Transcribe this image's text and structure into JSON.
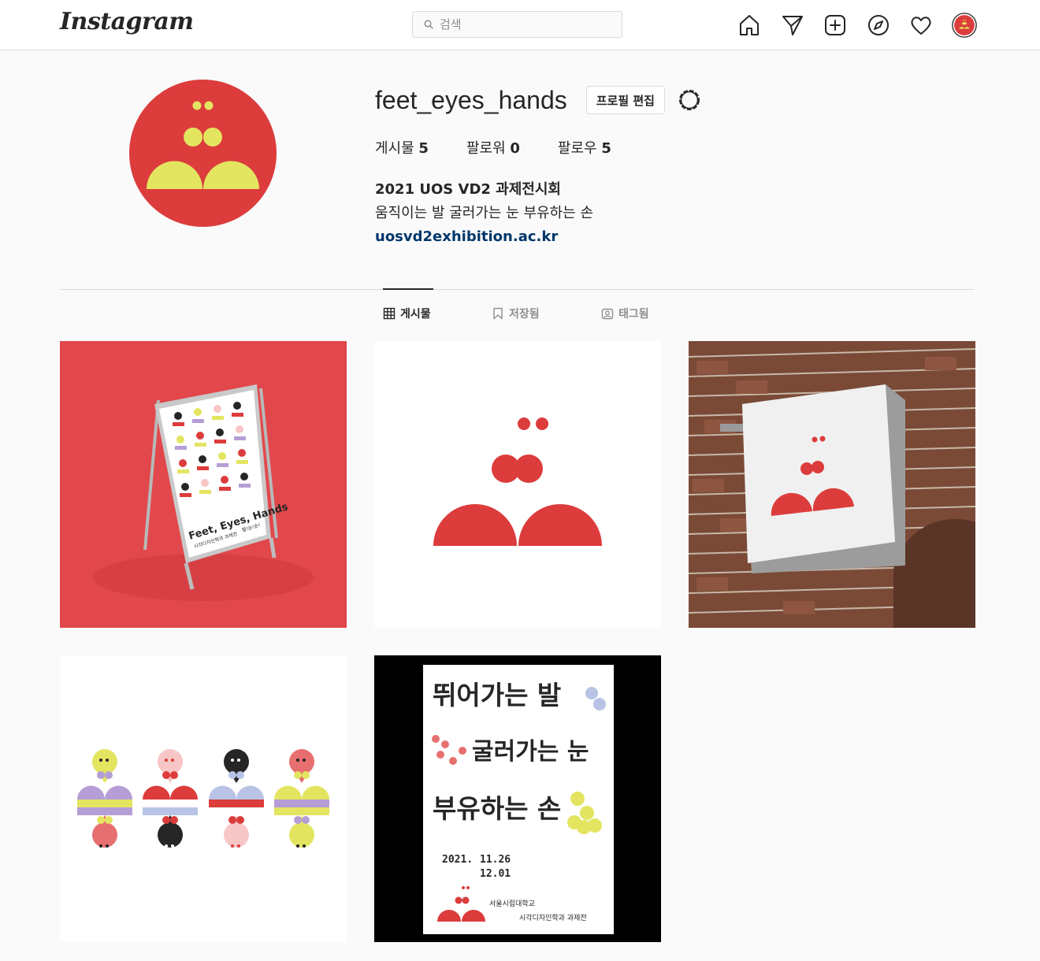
{
  "header": {
    "logo": "Instagram",
    "search_placeholder": "검색",
    "nav": [
      "home-icon",
      "direct-icon",
      "new-post-icon",
      "explore-icon",
      "activity-icon",
      "profile-avatar"
    ]
  },
  "profile": {
    "username": "feet_eyes_hands",
    "edit_label": "프로필 편집",
    "stats": [
      {
        "label": "게시물",
        "value": "5"
      },
      {
        "label": "팔로워",
        "value": "0"
      },
      {
        "label": "팔로우",
        "value": "5"
      }
    ],
    "bio_name": "2021 UOS VD2 과제전시회",
    "bio_text": "움직이는 발 굴러가는 눈 부유하는 손",
    "bio_link": "uosvd2exhibition.ac.kr"
  },
  "tabs": [
    {
      "label": "게시물",
      "icon": "grid-icon",
      "active": true
    },
    {
      "label": "저장됨",
      "icon": "bookmark-icon",
      "active": false
    },
    {
      "label": "태그됨",
      "icon": "tag-icon",
      "active": false
    }
  ],
  "posts": {
    "p1": {
      "sign_title": "Feet, Eyes, Hands",
      "sign_sub": "시각디자인학과 과제전",
      "sign_tag": "발!눈!손!"
    },
    "p5": {
      "line1": "뛰어가는 발",
      "line2": "굴러가는 눈",
      "line3": "부유하는 손",
      "date_label": "2021.",
      "date1": "11.26",
      "date2": "12.01",
      "org1": "서울시립대학교",
      "org2": "시각디자인학과 과제전"
    }
  },
  "colors": {
    "brand_red": "#dc3c3c",
    "brand_yellow": "#e3e561",
    "link": "#00376b"
  }
}
